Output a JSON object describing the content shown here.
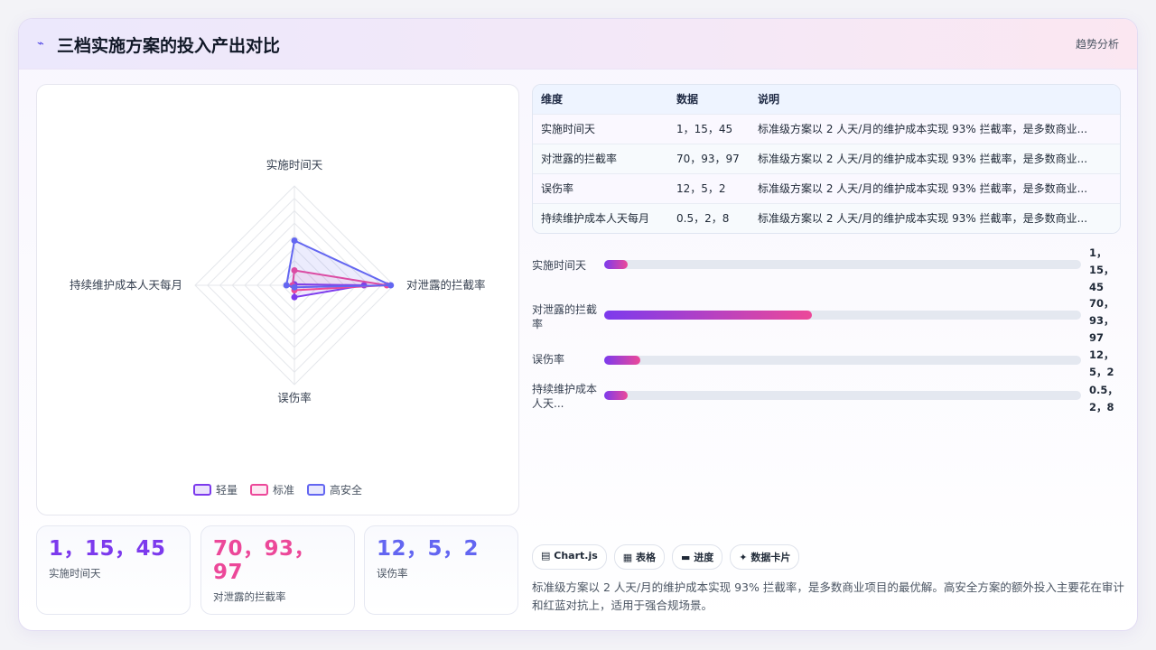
{
  "header": {
    "icon": "trend-icon",
    "title": "三档实施方案的投入产出对比",
    "link_label": "趋势分析"
  },
  "chart_data": {
    "type": "radar",
    "axes": [
      "实施时间天",
      "对泄露的拦截率",
      "误伤率",
      "持续维护成本人天每月"
    ],
    "series": [
      {
        "name": "轻量",
        "values": [
          1,
          70,
          12,
          0.5
        ],
        "color": "#7c3aed"
      },
      {
        "name": "标准",
        "values": [
          15,
          93,
          5,
          2
        ],
        "color": "#ec4899"
      },
      {
        "name": "高安全",
        "values": [
          45,
          97,
          2,
          8
        ],
        "color": "#6366f1"
      }
    ],
    "scale_max": 100,
    "grid": true,
    "legend_position": "bottom"
  },
  "kpis": [
    {
      "value": "1，15，45",
      "label": "实施时间天",
      "color": "#7c3aed"
    },
    {
      "value": "70，93，97",
      "label": "对泄露的拦截率",
      "color": "#ec4899"
    },
    {
      "value": "12，5，2",
      "label": "误伤率",
      "color": "#6366f1"
    }
  ],
  "table": {
    "columns": [
      "维度",
      "数据",
      "说明"
    ],
    "rows": [
      [
        "实施时间天",
        "1，15，45",
        "标准级方案以 2 人天/月的维护成本实现 93% 拦截率，是多数商业..."
      ],
      [
        "对泄露的拦截率",
        "70，93，97",
        "标准级方案以 2 人天/月的维护成本实现 93% 拦截率，是多数商业..."
      ],
      [
        "误伤率",
        "12，5，2",
        "标准级方案以 2 人天/月的维护成本实现 93% 拦截率，是多数商业..."
      ],
      [
        "持续维护成本人天每月",
        "0.5，2，8",
        "标准级方案以 2 人天/月的维护成本实现 93% 拦截率，是多数商业..."
      ]
    ]
  },
  "bars": [
    {
      "label": "实施时间天",
      "value": "1，15，45",
      "fill_percent": 5
    },
    {
      "label": "对泄露的拦截率",
      "value": "70，93，97",
      "fill_percent": 43.5
    },
    {
      "label": "误伤率",
      "value": "12，5，2",
      "fill_percent": 7.5
    },
    {
      "label": "持续维护成本人天...",
      "value": "0.5，2，8",
      "fill_percent": 5
    }
  ],
  "chips": [
    {
      "icon": "chart-icon",
      "glyph": "▤",
      "label": "Chart.js"
    },
    {
      "icon": "table-icon",
      "glyph": "▦",
      "label": "表格"
    },
    {
      "icon": "progress-icon",
      "glyph": "▬",
      "label": "进度"
    },
    {
      "icon": "sparkle-icon",
      "glyph": "✦",
      "label": "数据卡片"
    }
  ],
  "summary": "标准级方案以 2 人天/月的维护成本实现 93% 拦截率，是多数商业项目的最优解。高安全方案的额外投入主要花在审计和红蓝对抗上，适用于强合规场景。"
}
